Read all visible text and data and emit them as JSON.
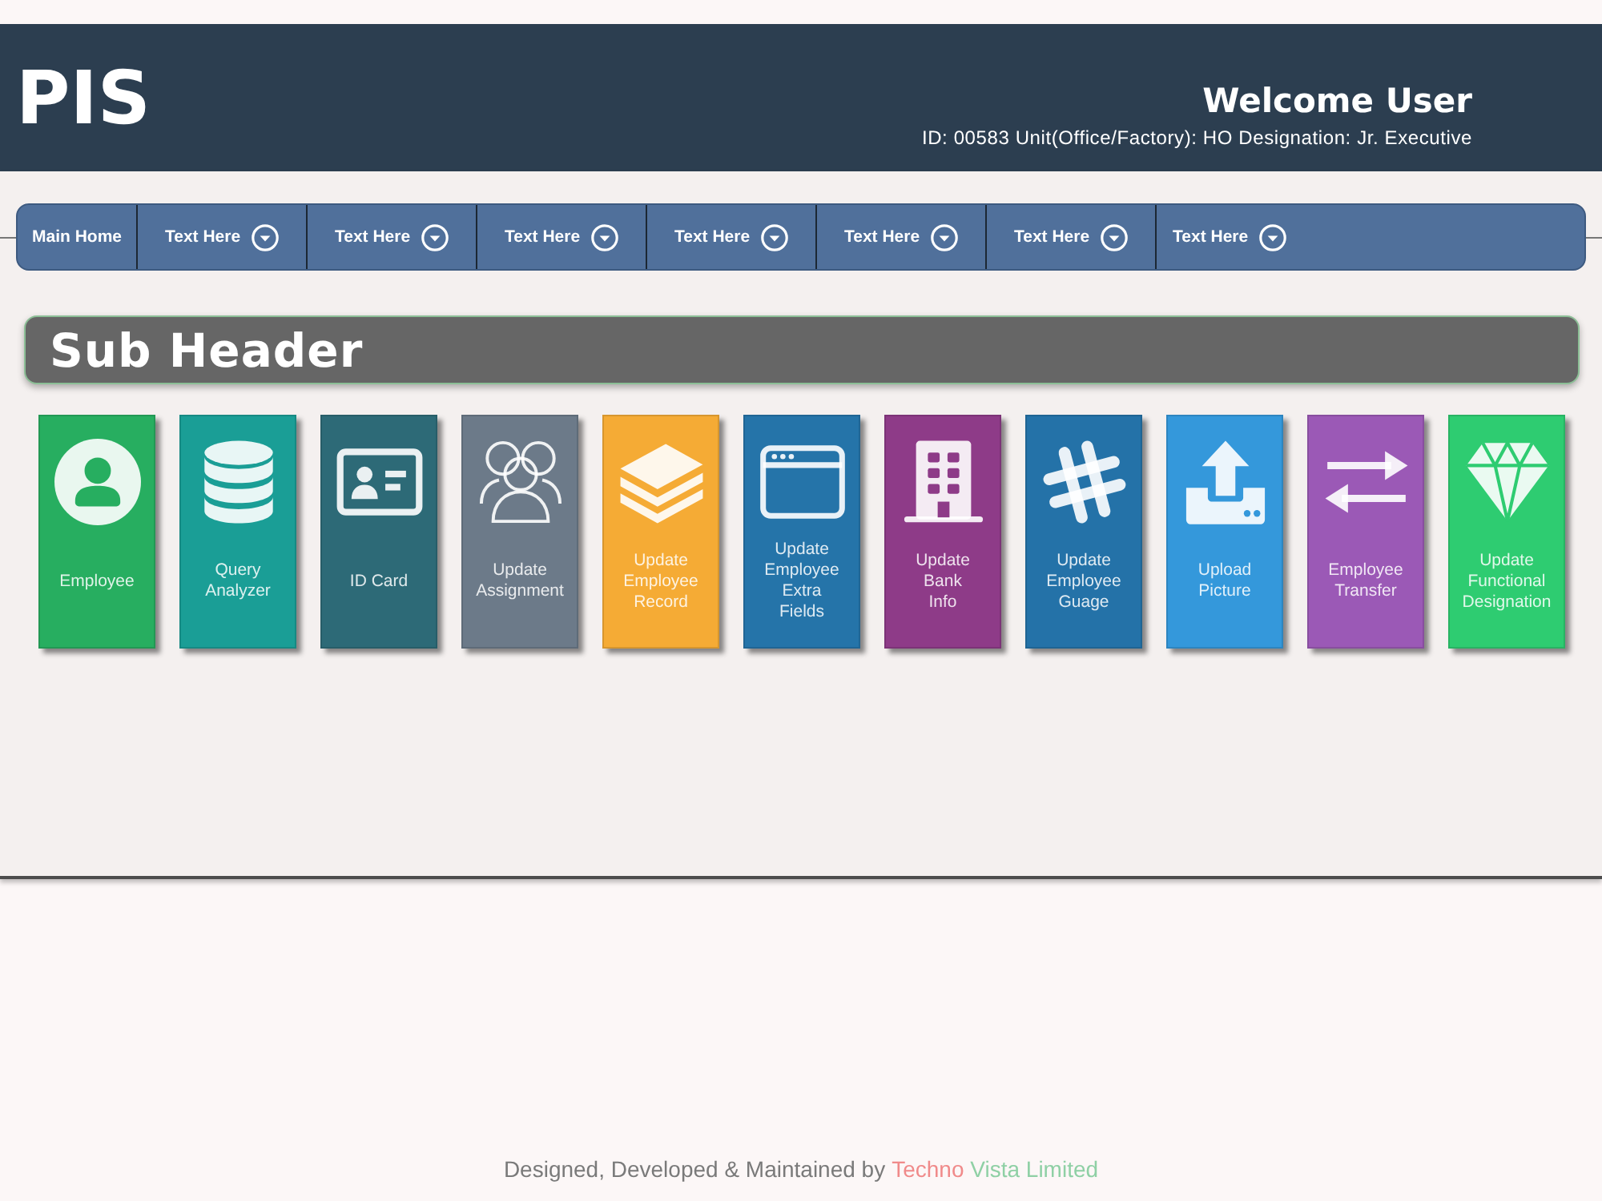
{
  "header": {
    "title": "PIS",
    "welcome": "Welcome User",
    "details": "ID: 00583 Unit(Office/Factory): HO Designation: Jr. Executive"
  },
  "nav": {
    "items": [
      {
        "label": "Main Home",
        "kind": "link"
      },
      {
        "label": "Text Here",
        "kind": "dropdown"
      },
      {
        "label": "Text Here",
        "kind": "dropdown"
      },
      {
        "label": "Text Here",
        "kind": "dropdown"
      },
      {
        "label": "Text Here",
        "kind": "dropdown"
      },
      {
        "label": "Text Here",
        "kind": "dropdown"
      },
      {
        "label": "Text Here",
        "kind": "dropdown"
      },
      {
        "label": "Text Here",
        "kind": "dropdown"
      }
    ]
  },
  "sub_header": {
    "title": "Sub Header"
  },
  "tiles": [
    {
      "label": "Employee",
      "color": "#27ae60"
    },
    {
      "label": "Query\nAnalyzer",
      "color": "#1a9e96"
    },
    {
      "label": "ID Card",
      "color": "#2d6a77"
    },
    {
      "label": "Update\nAssignment",
      "color": "#6c7a89"
    },
    {
      "label": "Update\nEmployee\nRecord",
      "color": "#f5ab35"
    },
    {
      "label": "Update\nEmployee\nExtra\nFields",
      "color": "#2574a9"
    },
    {
      "label": "Update\nBank\nInfo",
      "color": "#8e3b88"
    },
    {
      "label": "Update\nEmployee\nGuage",
      "color": "#2472a8"
    },
    {
      "label": "Upload\nPicture",
      "color": "#3498db"
    },
    {
      "label": "Employee\nTransfer",
      "color": "#9b59b6"
    },
    {
      "label": "Update\nFunctional\nDesignation",
      "color": "#2ecc71"
    }
  ],
  "footer": {
    "credit": "Designed, Developed & Maintained by",
    "company": [
      {
        "text": "Techno",
        "color": "#f08a8a"
      },
      {
        "text": "Vista Limited",
        "color": "#8fd0a5"
      }
    ]
  }
}
